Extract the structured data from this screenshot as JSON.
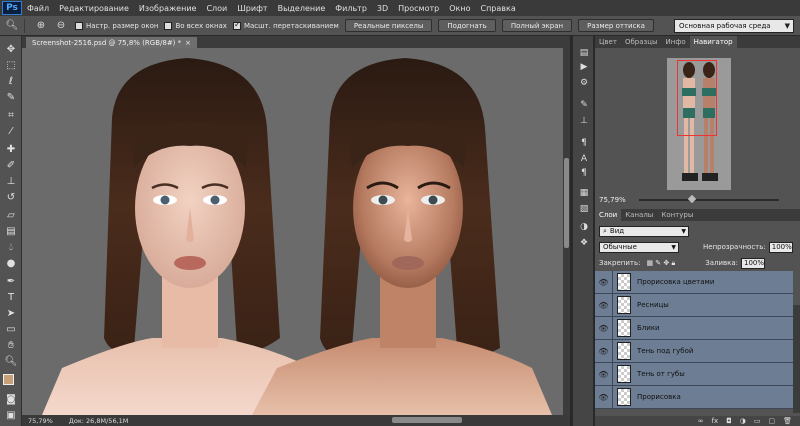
{
  "app": {
    "logo": "Ps"
  },
  "menu": [
    "Файл",
    "Редактирование",
    "Изображение",
    "Слои",
    "Шрифт",
    "Выделение",
    "Фильтр",
    "3D",
    "Просмотр",
    "Окно",
    "Справка"
  ],
  "options": {
    "resize_windows_label": "Настр. размер окон",
    "all_windows_label": "Во всех окнах",
    "scrubby_zoom_label": "Масшт. перетаскиванием",
    "actual_pixels_label": "Реальные пикселы",
    "fit_screen_label": "Подогнать",
    "fill_screen_label": "Полный экран",
    "print_size_label": "Размер оттиска",
    "workspace": "Основная рабочая среда"
  },
  "document": {
    "tab_title": "Screenshot-2516.psd @ 75,8% (RGB/8#) *",
    "zoom": "75,79%",
    "doc_size": "Док: 26,8M/56,1M"
  },
  "top_panel": {
    "tabs": [
      "Цвет",
      "Образцы",
      "Инфо",
      "Навигатор"
    ],
    "active_tab": "Навигатор",
    "navigator_zoom": "75,79%"
  },
  "layers_panel": {
    "tabs": [
      "Слои",
      "Каналы",
      "Контуры"
    ],
    "active_tab": "Слои",
    "filter_kind": "Вид",
    "blend_mode": "Обычные",
    "opacity_label": "Непрозрачность:",
    "opacity_value": "100%",
    "lock_label": "Закрепить:",
    "fill_label": "Заливка:",
    "fill_value": "100%",
    "layers": [
      "Прорисовка цветами",
      "Ресницы",
      "Блики",
      "Тень под губой",
      "Тень от губы",
      "Прорисовка"
    ],
    "bottom_icons": [
      "link-icon",
      "fx-icon",
      "mask-icon",
      "adjustment-icon",
      "folder-icon",
      "new-layer-icon",
      "trash-icon"
    ]
  }
}
